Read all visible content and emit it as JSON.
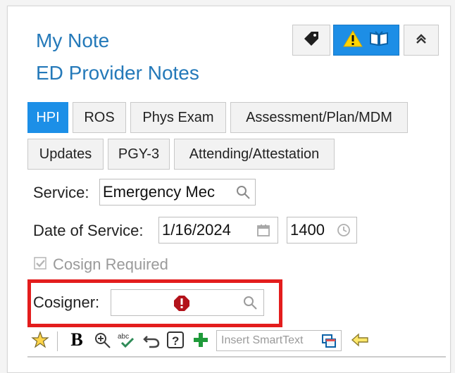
{
  "header": {
    "title": "My Note",
    "subtitle": "ED Provider Notes"
  },
  "tabs": {
    "row1": [
      "HPI",
      "ROS",
      "Phys Exam",
      "Assessment/Plan/MDM"
    ],
    "row2": [
      "Updates",
      "PGY-3",
      "Attending/Attestation"
    ],
    "active": "HPI"
  },
  "form": {
    "service_label": "Service:",
    "service_value": "Emergency Mec",
    "date_label": "Date of Service:",
    "date_value": "1/16/2024",
    "time_value": "1400",
    "cosign_required_label": "Cosign Required",
    "cosigner_label": "Cosigner:"
  },
  "toolbar": {
    "insert_smarttext_placeholder": "Insert SmartText"
  },
  "colors": {
    "accent_blue": "#1c8fe7",
    "title_blue": "#2479b9",
    "highlight_red": "#e31d1d",
    "error_red": "#b3131b"
  },
  "icons": {
    "tag": "tag-icon",
    "warning": "warning-icon",
    "book": "book-icon",
    "collapse": "chevron-up-double-icon",
    "search": "search-icon",
    "calendar": "calendar-icon",
    "clock": "clock-icon",
    "checkbox": "checkbox-checked-icon",
    "error": "error-icon",
    "star": "star-icon",
    "bold": "bold-icon",
    "zoom_in": "zoom-in-icon",
    "spellcheck": "spellcheck-icon",
    "undo": "undo-icon",
    "help": "help-icon",
    "add": "add-icon",
    "smarttext": "smarttext-icon",
    "arrow_left": "arrow-left-icon"
  }
}
